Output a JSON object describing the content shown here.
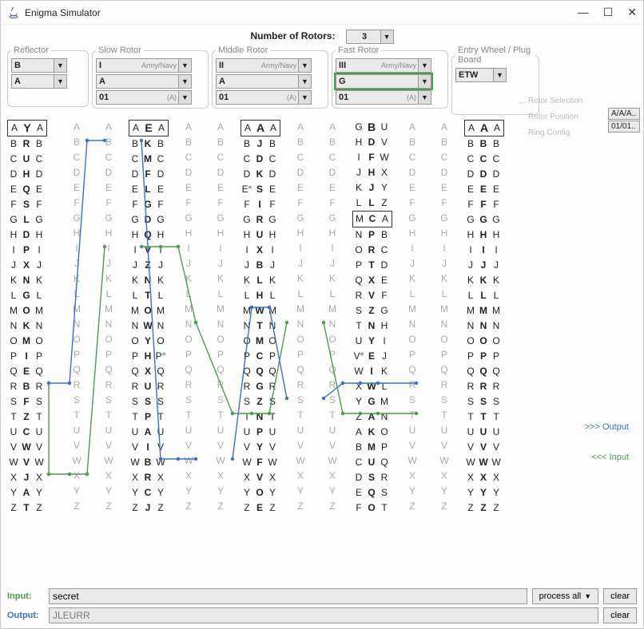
{
  "window": {
    "title": "Enigma Simulator"
  },
  "top": {
    "num_rotors_label": "Number of Rotors:",
    "num_rotors_value": "3"
  },
  "rightLabels": {
    "selection": "Rotor Selection",
    "position": "Rotor Position",
    "ring": "Ring Config"
  },
  "status": {
    "position": "A/A/A..",
    "ring": "01/01.."
  },
  "reflector": {
    "legend": "Reflector",
    "type": "B",
    "position": "A",
    "leftCol": [
      "A",
      "B",
      "C",
      "D",
      "E",
      "F",
      "G",
      "H",
      "I",
      "J",
      "K",
      "L",
      "M",
      "N",
      "O",
      "P",
      "Q",
      "R",
      "S",
      "T",
      "U",
      "V",
      "W",
      "X",
      "Y",
      "Z"
    ],
    "midCol": [
      "Y",
      "R",
      "U",
      "H",
      "Q",
      "S",
      "L",
      "D",
      "P",
      "X",
      "N",
      "G",
      "O",
      "K",
      "M",
      "I",
      "E",
      "B",
      "F",
      "Z",
      "C",
      "W",
      "V",
      "J",
      "A",
      "T"
    ],
    "rightCol": [
      "A",
      "B",
      "C",
      "D",
      "E",
      "F",
      "G",
      "H",
      "I",
      "J",
      "K",
      "L",
      "M",
      "N",
      "O",
      "P",
      "Q",
      "R",
      "S",
      "T",
      "U",
      "V",
      "W",
      "X",
      "Y",
      "Z"
    ],
    "grayCol": [
      "A",
      "B",
      "C",
      "D",
      "E",
      "F",
      "G",
      "H",
      "I",
      "J",
      "K",
      "L",
      "M",
      "N",
      "O",
      "P",
      "Q",
      "R",
      "S",
      "T",
      "U",
      "V",
      "W",
      "X",
      "Y",
      "Z"
    ]
  },
  "slow": {
    "legend": "Slow Rotor",
    "type": "I",
    "army": "Army/Navy",
    "position": "A",
    "ring": "01",
    "ringLetter": "(A)",
    "leftCol": [
      "A",
      "B",
      "C",
      "D",
      "E",
      "F",
      "G",
      "H",
      "I",
      "J",
      "K",
      "L",
      "M",
      "N",
      "O",
      "P",
      "Q",
      "R",
      "S",
      "T",
      "U",
      "V",
      "W",
      "X",
      "Y",
      "Z"
    ],
    "midCol": [
      "E",
      "K",
      "M",
      "F",
      "L",
      "G",
      "D",
      "Q",
      "V",
      "Z",
      "N",
      "T",
      "O",
      "W",
      "Y",
      "H",
      "X",
      "U",
      "S",
      "P",
      "A",
      "I",
      "B",
      "R",
      "C",
      "J"
    ],
    "rightCol": [
      "A",
      "B",
      "C",
      "D",
      "E",
      "F",
      "G",
      "H",
      "I",
      "J",
      "K",
      "L",
      "M",
      "N",
      "O",
      "P°",
      "Q",
      "R",
      "S",
      "T",
      "U",
      "V",
      "W",
      "X",
      "Y",
      "Z"
    ],
    "grayL": [
      "A",
      "B",
      "C",
      "D",
      "E",
      "F",
      "G",
      "H",
      "I",
      "J",
      "K",
      "L",
      "M",
      "N",
      "O",
      "P",
      "Q",
      "R",
      "S",
      "T",
      "U",
      "V",
      "W",
      "X",
      "Y",
      "Z"
    ],
    "grayR": [
      "A",
      "B",
      "C",
      "D",
      "E",
      "F",
      "G",
      "H",
      "I",
      "J",
      "K",
      "L",
      "M",
      "N",
      "O",
      "P",
      "Q",
      "R",
      "S",
      "T",
      "U",
      "V",
      "W",
      "X",
      "Y",
      "Z"
    ]
  },
  "middle": {
    "legend": "Middle Rotor",
    "type": "II",
    "army": "Army/Navy",
    "position": "A",
    "ring": "01",
    "ringLetter": "(A)",
    "leftCol": [
      "A",
      "B",
      "C",
      "D",
      "E°",
      "F",
      "G",
      "H",
      "I",
      "J",
      "K",
      "L",
      "M",
      "N",
      "O",
      "P",
      "Q",
      "R",
      "S",
      "T",
      "U",
      "V",
      "W",
      "X",
      "Y",
      "Z"
    ],
    "midCol": [
      "A",
      "J",
      "D",
      "K",
      "S",
      "I",
      "R",
      "U",
      "X",
      "B",
      "L",
      "H",
      "W",
      "T",
      "M",
      "C",
      "Q",
      "G",
      "Z",
      "N",
      "P",
      "Y",
      "F",
      "V",
      "O",
      "E"
    ],
    "rightCol": [
      "A",
      "B",
      "C",
      "D",
      "E",
      "F",
      "G",
      "H",
      "I",
      "J",
      "K",
      "L",
      "M",
      "N",
      "O",
      "P",
      "Q",
      "R",
      "S",
      "T",
      "U",
      "V",
      "W",
      "X",
      "Y",
      "Z"
    ],
    "grayL": [
      "A",
      "B",
      "C",
      "D",
      "E",
      "F",
      "G",
      "H",
      "I",
      "J",
      "K",
      "L",
      "M",
      "N",
      "O",
      "P",
      "Q",
      "R",
      "S",
      "T",
      "U",
      "V",
      "W",
      "X",
      "Y",
      "Z"
    ],
    "grayR": [
      "A",
      "B",
      "C",
      "D",
      "E",
      "F",
      "G",
      "H",
      "I",
      "J",
      "K",
      "L",
      "M",
      "N",
      "O",
      "P",
      "Q",
      "R",
      "S",
      "T",
      "U",
      "V",
      "W",
      "X",
      "Y",
      "Z"
    ]
  },
  "fast": {
    "legend": "Fast Rotor",
    "type": "III",
    "army": "Army/Navy",
    "position": "G",
    "ring": "01",
    "ringLetter": "(A)",
    "leftCol": [
      "G",
      "H",
      "I",
      "J",
      "K",
      "L",
      "M",
      "N",
      "O",
      "P",
      "Q",
      "R",
      "S",
      "T",
      "U",
      "V°",
      "W",
      "X",
      "Y",
      "Z",
      "A",
      "B",
      "C",
      "D",
      "E",
      "F"
    ],
    "midCol": [
      "B",
      "D",
      "F",
      "H",
      "J",
      "L",
      "C",
      "P",
      "R",
      "T",
      "X",
      "V",
      "Z",
      "N",
      "Y",
      "E",
      "I",
      "W",
      "G",
      "A",
      "K",
      "M",
      "U",
      "S",
      "Q",
      "O"
    ],
    "rightCol": [
      "U",
      "V",
      "W",
      "X",
      "Y",
      "Z",
      "A",
      "B",
      "C",
      "D",
      "E",
      "F",
      "G",
      "H",
      "I",
      "J",
      "K",
      "L",
      "M",
      "N",
      "O",
      "P",
      "Q",
      "R",
      "S",
      "T"
    ],
    "grayL": [
      "A",
      "B",
      "C",
      "D",
      "E",
      "F",
      "G",
      "H",
      "I",
      "J",
      "K",
      "L",
      "M",
      "N",
      "O",
      "P",
      "Q",
      "R",
      "S",
      "T",
      "U",
      "V",
      "W",
      "X",
      "Y",
      "Z"
    ],
    "grayR": [
      "A",
      "B",
      "C",
      "D",
      "E",
      "F",
      "G",
      "H",
      "I",
      "J",
      "K",
      "L",
      "M",
      "N",
      "O",
      "P",
      "Q",
      "R",
      "S",
      "T",
      "U",
      "V",
      "W",
      "X",
      "Y",
      "Z"
    ],
    "notch": [
      "M",
      "C",
      "A"
    ]
  },
  "entry": {
    "legend": "Entry Wheel / Plug Board",
    "type": "ETW",
    "leftCol": [
      "A",
      "B",
      "C",
      "D",
      "E",
      "F",
      "G",
      "H",
      "I",
      "J",
      "K",
      "L",
      "M",
      "N",
      "O",
      "P",
      "Q",
      "R",
      "S",
      "T",
      "U",
      "V",
      "W",
      "X",
      "Y",
      "Z"
    ],
    "midCol": [
      "A",
      "B",
      "C",
      "D",
      "E",
      "F",
      "G",
      "H",
      "I",
      "J",
      "K",
      "L",
      "M",
      "N",
      "O",
      "P",
      "Q",
      "R",
      "S",
      "T",
      "U",
      "V",
      "W",
      "X",
      "Y",
      "Z"
    ],
    "rightCol": [
      "A",
      "B",
      "C",
      "D",
      "E",
      "F",
      "G",
      "H",
      "I",
      "J",
      "K",
      "L",
      "M",
      "N",
      "O",
      "P",
      "Q",
      "R",
      "S",
      "T",
      "U",
      "V",
      "W",
      "X",
      "Y",
      "Z"
    ],
    "grayL": [
      "A",
      "B",
      "C",
      "D",
      "E",
      "F",
      "G",
      "H",
      "I",
      "J",
      "K",
      "L",
      "M",
      "N",
      "O",
      "P",
      "Q",
      "R",
      "S",
      "T",
      "U",
      "V",
      "W",
      "X",
      "Y",
      "Z"
    ]
  },
  "io": {
    "outputLabel": ">>> Output",
    "inputLabel": "<<< Input",
    "input_label": "Input:",
    "output_label": "Output:",
    "input_value": "secret",
    "output_value": "JLEURR",
    "process_label": "process all",
    "clear_label": "clear"
  }
}
